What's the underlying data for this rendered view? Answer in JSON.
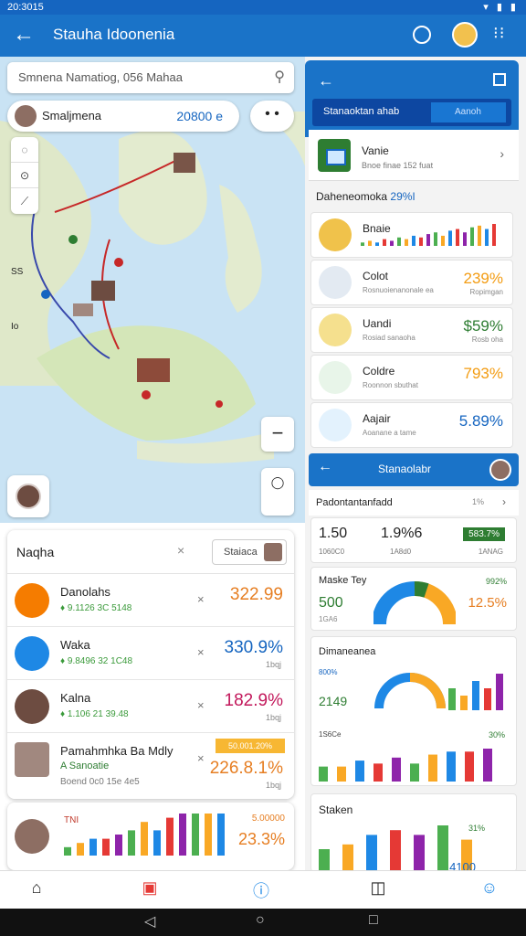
{
  "status_bar": {
    "time": "20:3015",
    "icons": "▾ ▮ ▮"
  },
  "app_bar": {
    "title": "Stauha Idoonenia"
  },
  "map": {
    "search_placeholder": "Smnena Namatiog, 056 Mahaa",
    "location_pill": {
      "label": "Smaljmena",
      "value": "20800 e"
    },
    "controls": [
      "◌",
      "⊙",
      "⟋"
    ],
    "zoom_label": "−",
    "shield_label": "◯",
    "map_labels": [
      "SS",
      "Io"
    ]
  },
  "list_card": {
    "title": "Naqha",
    "close": "×",
    "filter_button": "Staiaca",
    "rows": [
      {
        "name": "Danolahs",
        "sub": "♦ 9.1126 3C 5148",
        "value": "322.99",
        "value_color": "#e67e22",
        "icon_color": "#f57c00"
      },
      {
        "name": "Waka",
        "sub": "♦ 9.8496 32 1C48",
        "value": "330.9%",
        "value_color": "#1565c0",
        "sub_value": "1bqj",
        "icon_color": "#1e88e5"
      },
      {
        "name": "Kalna",
        "sub": "♦ 1.106 21 39.48",
        "value": "182.9%",
        "value_color": "#c2185b",
        "sub_value": "1bqj",
        "icon_color": "#6d4c41"
      },
      {
        "name": "Pamahmhka Ba Mdly",
        "name2": "A Sanoatie",
        "sub": "Boend 0c0 15e 4e5",
        "value": "226.8.1%",
        "value_color": "#e67e22",
        "sub_value": "1bqj",
        "tag": "50.001.20%",
        "icon_color": "#a1887f"
      }
    ]
  },
  "bar_card": {
    "label": "TNI",
    "value_top": "5.00000",
    "value": "23.3%",
    "bars": [
      2,
      3,
      4,
      4,
      5,
      6,
      8,
      6,
      9,
      10,
      10,
      10,
      10
    ]
  },
  "right_panel": {
    "back_icon": "←",
    "header_tabs": {
      "active": "Stanaoktan ahab",
      "inactive": "Aanoh"
    },
    "venue": {
      "name": "Vanie",
      "sub": "Bnoe finae 152 fuat"
    },
    "section": {
      "title": "Daheneomoka",
      "value": "29%I"
    },
    "metrics": [
      {
        "name": "Bnaie",
        "sub": "",
        "value": "",
        "value_color": "#1565c0",
        "icon_color": "#f0c24b"
      },
      {
        "name": "Colot",
        "sub": "Rosnuoienanonale ea",
        "value": "239%",
        "value_color": "#f39c12",
        "sub_value": "Ropimgan",
        "icon_color": "#e3eaf2"
      },
      {
        "name": "Uandi",
        "sub": "Rosiad sanaoha",
        "value": "$59%",
        "value_color": "#2e7d32",
        "sub_value": "Rosb oha",
        "icon_color": "#f5e08e"
      },
      {
        "name": "Coldre",
        "sub": "Roonnon sbuthat",
        "value": "793%",
        "value_color": "#f39c12",
        "sub_value": "",
        "icon_color": "#e8f5e9"
      },
      {
        "name": "Aajair",
        "sub": "Aoanane a tame",
        "value": "5.89%",
        "value_color": "#1565c0",
        "sub_value": "",
        "icon_color": "#e3f2fd"
      }
    ],
    "second_header": {
      "title": "Stanaolabr"
    },
    "perf": {
      "title": "Padontantanfadd",
      "count": "1%"
    },
    "stats": {
      "a": "1.50",
      "a_sub": "1060C0",
      "b": "1.9%6",
      "b_sub": "1A8d0",
      "c": "583.7%",
      "c_sub": "1ANAG"
    },
    "gauge": {
      "title": "Maske Tey",
      "value": "500",
      "sub": "1GA6",
      "right_top": "992%",
      "right_value": "12.5%"
    },
    "donut": {
      "title": "Dimaneanea",
      "l1": "800%",
      "l2": "2149",
      "l3": "1S6Ce",
      "l4": "30%",
      "bars": [
        3,
        2,
        4,
        3,
        5
      ],
      "bars2": [
        5,
        5,
        7,
        6,
        8,
        6,
        9,
        10,
        10,
        11
      ]
    },
    "staken": {
      "title": "Staken",
      "r1": "31%",
      "r2": "4100",
      "bars": [
        5,
        6,
        8,
        9,
        8,
        10,
        7
      ]
    }
  },
  "bottom_nav": [
    "⌂",
    "▣",
    "ⓘ",
    "◫",
    "☺"
  ],
  "system_nav": [
    "◁",
    "○",
    "□"
  ]
}
